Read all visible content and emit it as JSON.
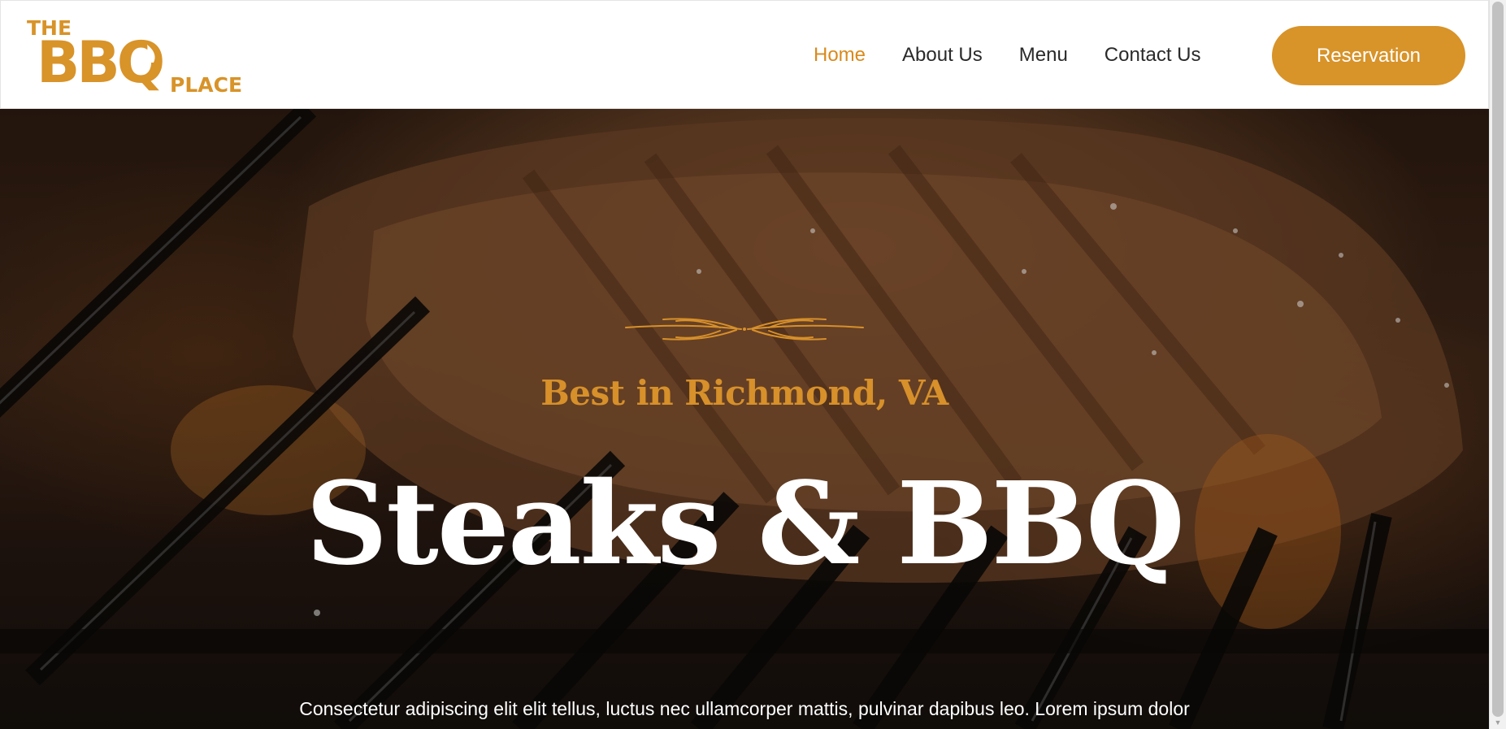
{
  "brand": {
    "logo_line1": "THE",
    "logo_line2": "BBQ",
    "logo_line3": "PLACE",
    "color": "#d89329"
  },
  "nav": {
    "items": [
      {
        "label": "Home",
        "active": true
      },
      {
        "label": "About Us",
        "active": false
      },
      {
        "label": "Menu",
        "active": false
      },
      {
        "label": "Contact Us",
        "active": false
      }
    ],
    "cta_label": "Reservation"
  },
  "hero": {
    "tagline": "Best in Richmond, VA",
    "title": "Steaks & BBQ",
    "description": "Consectetur adipiscing elit elit tellus, luctus nec ullamcorper mattis, pulvinar dapibus leo. Lorem ipsum dolor sit amet, consectetur adipiscing elit.",
    "accent_color": "#d7902a",
    "background": "grilled-steak-photo"
  },
  "icons": {
    "ornament": "wheat-divider-icon",
    "scroll_down": "chevron-down-icon"
  }
}
